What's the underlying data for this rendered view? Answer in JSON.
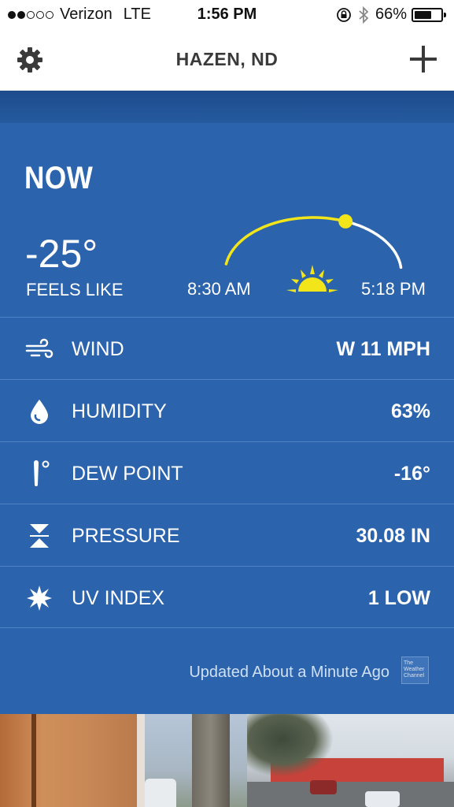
{
  "status_bar": {
    "carrier": "Verizon",
    "network": "LTE",
    "time": "1:56 PM",
    "battery_percent": "66%",
    "battery_level": 0.66,
    "signal_bars_filled": 2,
    "signal_bars_total": 5
  },
  "nav": {
    "title": "HAZEN, ND",
    "settings_icon": "gear-icon",
    "add_icon": "plus-icon"
  },
  "now": {
    "title": "NOW",
    "temperature": "-25°",
    "feels_like_label": "FEELS LIKE",
    "sunrise": "8:30 AM",
    "sunset": "5:18 PM",
    "sun_progress": 0.62
  },
  "conditions": [
    {
      "icon": "wind-icon",
      "label": "WIND",
      "value": "W 11 MPH"
    },
    {
      "icon": "droplet-icon",
      "label": "HUMIDITY",
      "value": "63%"
    },
    {
      "icon": "thermometer-icon",
      "label": "DEW POINT",
      "value": "-16°"
    },
    {
      "icon": "pressure-icon",
      "label": "PRESSURE",
      "value": "30.08 IN"
    },
    {
      "icon": "sun-burst-icon",
      "label": "UV INDEX",
      "value": "1 LOW"
    }
  ],
  "footer": {
    "updated_text": "Updated About a Minute Ago",
    "logo_text": "The Weather Channel"
  },
  "colors": {
    "card_bg": "#2b63ad",
    "divider": "#4f83c6",
    "sun_yellow": "#f2e51a",
    "arc_white": "#ffffff"
  }
}
